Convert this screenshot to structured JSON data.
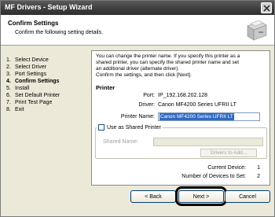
{
  "window": {
    "title": "MF Drivers - Setup Wizard"
  },
  "header": {
    "title": "Confirm Settings",
    "subtitle": "Confirm the following setting details."
  },
  "steps": [
    {
      "num": "1.",
      "label": "Select Device",
      "active": false
    },
    {
      "num": "2.",
      "label": "Select Driver",
      "active": false
    },
    {
      "num": "3.",
      "label": "Port Settings",
      "active": false
    },
    {
      "num": "4.",
      "label": "Confirm Settings",
      "active": true
    },
    {
      "num": "5.",
      "label": "Install",
      "active": false
    },
    {
      "num": "6.",
      "label": "Set Default Printer",
      "active": false
    },
    {
      "num": "7.",
      "label": "Print Test Page",
      "active": false
    },
    {
      "num": "8.",
      "label": "Exit",
      "active": false
    }
  ],
  "content": {
    "intro_lines": [
      "You can change the printer name. If you specify this printer as a",
      "shared printer, you can specify the shared printer name and set",
      "an additional driver (alternate driver).",
      "Confirm the settings, and then click [Next]."
    ],
    "section_title": "Printer",
    "port_label": "Port:",
    "port_value": "IP_192.168.202.128",
    "driver_label": "Driver:",
    "driver_value": "Canon MF4200 Series UFRII LT",
    "printer_name_label": "Printer Name:",
    "printer_name_value": "Canon MF4200 Series UFRII LT",
    "shared_checkbox_label": "Use as Shared Printer",
    "shared_name_label": "Shared Name:",
    "drivers_button": "Drivers to Add...",
    "current_device_label": "Current Device:",
    "current_device_value": "1",
    "num_devices_label": "Number of Devices to Set:",
    "num_devices_value": "2"
  },
  "buttons": {
    "back": "< Back",
    "next": "Next >",
    "cancel": "Cancel"
  }
}
